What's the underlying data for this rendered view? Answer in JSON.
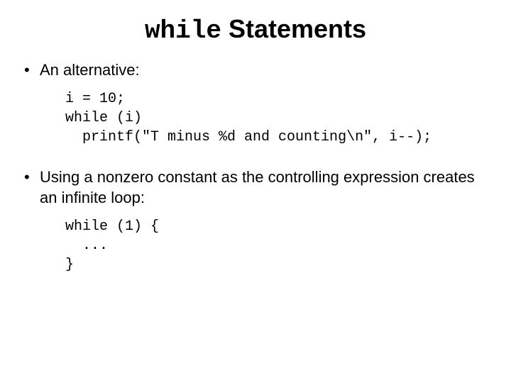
{
  "title": {
    "keyword": "while",
    "rest": " Statements"
  },
  "bullets": [
    {
      "text": "An alternative:",
      "code": "i = 10;\nwhile (i)\n  printf(\"T minus %d and counting\\n\", i--);"
    },
    {
      "text": "Using a nonzero constant as the controlling expression creates an infinite loop:",
      "code": "while (1) {\n  ...\n}"
    }
  ]
}
